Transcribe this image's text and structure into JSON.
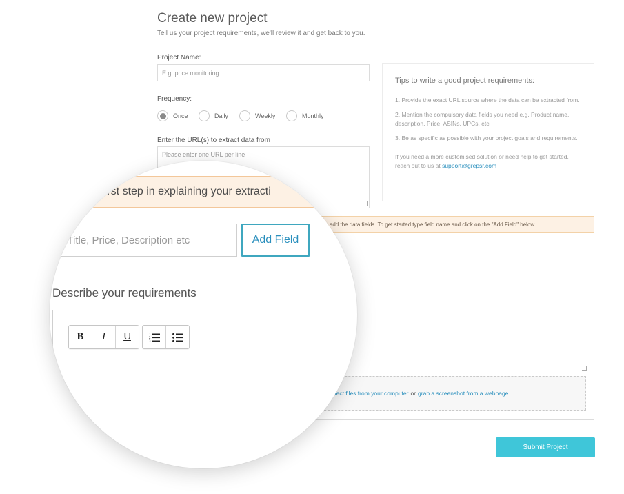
{
  "form": {
    "title": "Create new project",
    "subtitle": "Tell us your project requirements, we'll review it and get back to you.",
    "project_name": {
      "label": "Project Name:",
      "placeholder": "E.g. price monitoring"
    },
    "frequency": {
      "label": "Frequency:",
      "options": [
        "Once",
        "Daily",
        "Weekly",
        "Monthly"
      ],
      "selected": "Once"
    },
    "urls": {
      "label": "Enter the URL(s) to extract data from",
      "placeholder": "Please enter one URL per line"
    },
    "notice": "to add the data fields. To get started type field name and click on the \"Add Field\" below.",
    "upload": {
      "link1": "elect files from your computer",
      "separator": "or",
      "link2": "grab a screenshot from a webpage"
    },
    "submit_label": "Submit Project"
  },
  "tips": {
    "title": "Tips to write a good project requirements:",
    "items": [
      "1. Provide the exact URL source where the data can be extracted from.",
      "2. Mention the compulsory data fields you need e.g. Product name, description, Price, ASINs, UPCs, etc",
      "3. Be as specific as possible with your project goals and requirements."
    ],
    "contact_text": "If you need a more customised solution or need help to get started, reach out to us at",
    "contact_email": "support@grepsr.com"
  },
  "magnifier": {
    "banner": "e first step in explaining your extracti",
    "field_placeholder": "g. Title, Price, Description etc",
    "add_field_label": "Add Field",
    "heading": "Describe your requirements",
    "toolbar": {
      "bold": "B",
      "italic": "I",
      "underline": "U"
    }
  },
  "colors": {
    "accent": "#3fc6d9",
    "link": "#2a8fbd",
    "notice_bg": "#fdf1e4"
  }
}
